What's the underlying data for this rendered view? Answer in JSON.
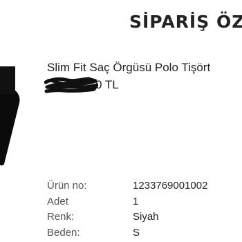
{
  "header": {
    "title": "SİPARİŞ ÖZI"
  },
  "product": {
    "name": "Slim Fit Saç Örgüsü Polo Tişört",
    "price_visible": "0 TL",
    "image_icon": "product-thumbnail"
  },
  "details": [
    {
      "label": "Ürün no:",
      "value": "1233769001002"
    },
    {
      "label": "Adet",
      "value": "1"
    },
    {
      "label": "Renk:",
      "value": "Siyah"
    },
    {
      "label": "Beden:",
      "value": "S"
    }
  ],
  "colors": {
    "text": "#222222",
    "label": "#555555",
    "thumbnail": "#0b0b0b"
  }
}
